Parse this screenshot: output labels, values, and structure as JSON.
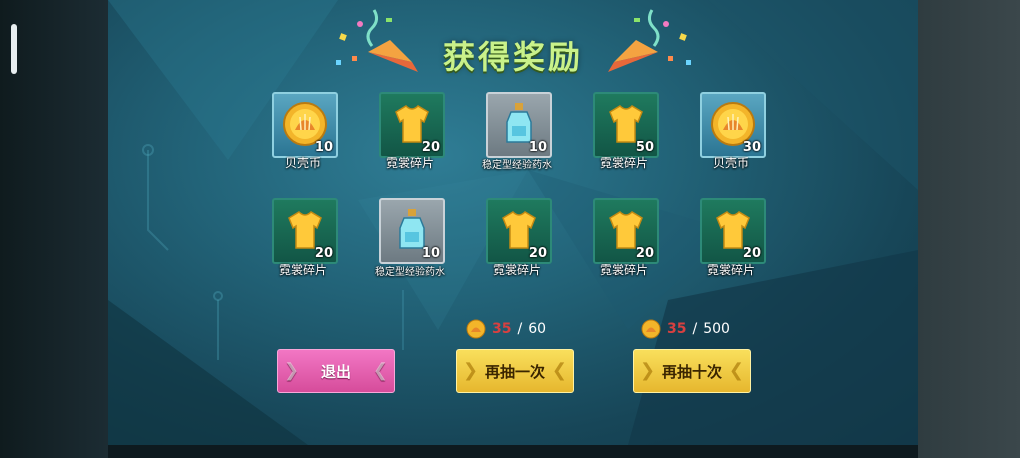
{
  "title": "获得奖励",
  "rewards": [
    {
      "name": "贝壳币",
      "qty": "10",
      "icon": "shell-coin-icon",
      "frame": "blue"
    },
    {
      "name": "霓裳碎片",
      "qty": "20",
      "icon": "shirt-fragment-icon",
      "frame": "green"
    },
    {
      "name": "稳定型经验药水",
      "qty": "10",
      "icon": "exp-potion-icon",
      "frame": "grey"
    },
    {
      "name": "霓裳碎片",
      "qty": "50",
      "icon": "shirt-fragment-icon",
      "frame": "green"
    },
    {
      "name": "贝壳币",
      "qty": "30",
      "icon": "shell-coin-icon",
      "frame": "blue"
    },
    {
      "name": "霓裳碎片",
      "qty": "20",
      "icon": "shirt-fragment-icon",
      "frame": "green"
    },
    {
      "name": "稳定型经验药水",
      "qty": "10",
      "icon": "exp-potion-icon",
      "frame": "grey"
    },
    {
      "name": "霓裳碎片",
      "qty": "20",
      "icon": "shirt-fragment-icon",
      "frame": "green"
    },
    {
      "name": "霓裳碎片",
      "qty": "20",
      "icon": "shirt-fragment-icon",
      "frame": "green"
    },
    {
      "name": "霓裳碎片",
      "qty": "20",
      "icon": "shirt-fragment-icon",
      "frame": "green"
    }
  ],
  "buttons": {
    "exit": "退出",
    "draw_once": "再抽一次",
    "draw_ten": "再抽十次"
  },
  "cost_once": {
    "have": "35",
    "separator": "/",
    "need": "60"
  },
  "cost_ten": {
    "have": "35",
    "separator": "/",
    "need": "500"
  },
  "colors": {
    "title": "#c9f28a",
    "exit_button": "#e05fae",
    "draw_button": "#f2c941",
    "insufficient": "#d84040"
  }
}
